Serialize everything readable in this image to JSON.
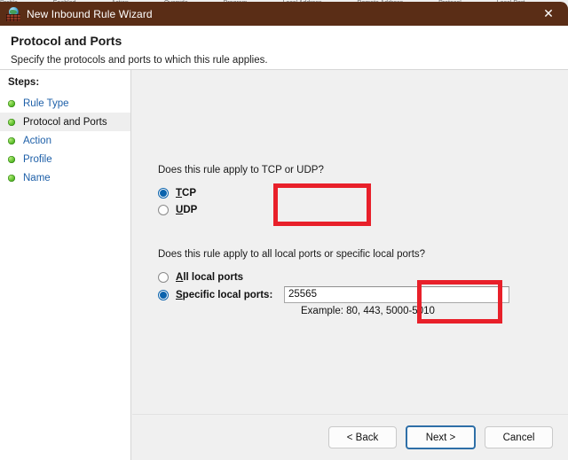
{
  "background": {
    "partial_texts": [
      "Profile",
      "Enabled",
      "Action",
      "Override",
      "Program",
      "Local Address",
      "Remote Address",
      "Protocol",
      "Local Port"
    ]
  },
  "window": {
    "title": "New Inbound Rule Wizard",
    "icon": "firewall-globe-wall-icon",
    "close_label": "✕",
    "titlebar_color": "#5a2d16"
  },
  "header": {
    "title": "Protocol and Ports",
    "subtitle": "Specify the protocols and ports to which this rule applies."
  },
  "sidebar": {
    "label": "Steps:",
    "items": [
      {
        "label": "Rule Type",
        "current": false
      },
      {
        "label": "Protocol and Ports",
        "current": true
      },
      {
        "label": "Action",
        "current": false
      },
      {
        "label": "Profile",
        "current": false
      },
      {
        "label": "Name",
        "current": false
      }
    ]
  },
  "main": {
    "question_protocol": "Does this rule apply to TCP or UDP?",
    "question_ports": "Does this rule apply to all local ports or specific local ports?",
    "protocol_options": [
      {
        "label": "TCP",
        "accelerator": "T",
        "rest": "CP",
        "selected": true
      },
      {
        "label": "UDP",
        "accelerator": "U",
        "rest": "DP",
        "selected": false
      }
    ],
    "port_scope_options": [
      {
        "label": "All local ports",
        "accelerator": "A",
        "rest": "ll local ports",
        "selected": false
      },
      {
        "label": "Specific local ports:",
        "accelerator": "S",
        "rest": "pecific local ports:",
        "selected": true
      }
    ],
    "port_value": "25565",
    "port_example": "Example: 80, 443, 5000-5010"
  },
  "annotations": {
    "color": "#e8202a",
    "boxes": [
      "protocol-options-highlight",
      "specific-ports-highlight"
    ]
  },
  "footer": {
    "back_label": "< Back",
    "next_label": "Next >",
    "cancel_label": "Cancel"
  }
}
